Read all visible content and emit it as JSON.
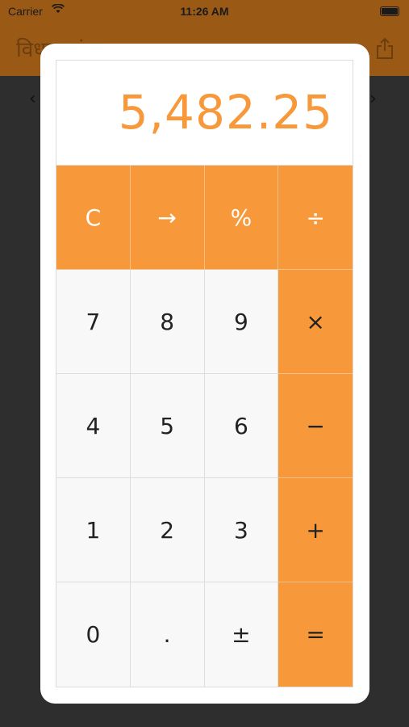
{
  "status_bar": {
    "carrier": "Carrier",
    "time": "11:26 AM"
  },
  "background_app": {
    "nav_title": "विधान संग्रह"
  },
  "calculator": {
    "display": "5,482.25",
    "keys": [
      {
        "label": "C",
        "name": "clear-key",
        "style": "orange"
      },
      {
        "label": "→",
        "name": "backspace-key",
        "style": "orange"
      },
      {
        "label": "%",
        "name": "percent-key",
        "style": "orange"
      },
      {
        "label": "÷",
        "name": "divide-key",
        "style": "orange"
      },
      {
        "label": "7",
        "name": "digit-7-key",
        "style": "light"
      },
      {
        "label": "8",
        "name": "digit-8-key",
        "style": "light"
      },
      {
        "label": "9",
        "name": "digit-9-key",
        "style": "light"
      },
      {
        "label": "×",
        "name": "multiply-key",
        "style": "op"
      },
      {
        "label": "4",
        "name": "digit-4-key",
        "style": "light"
      },
      {
        "label": "5",
        "name": "digit-5-key",
        "style": "light"
      },
      {
        "label": "6",
        "name": "digit-6-key",
        "style": "light"
      },
      {
        "label": "−",
        "name": "subtract-key",
        "style": "op"
      },
      {
        "label": "1",
        "name": "digit-1-key",
        "style": "light"
      },
      {
        "label": "2",
        "name": "digit-2-key",
        "style": "light"
      },
      {
        "label": "3",
        "name": "digit-3-key",
        "style": "light"
      },
      {
        "label": "+",
        "name": "add-key",
        "style": "op"
      },
      {
        "label": "0",
        "name": "digit-0-key",
        "style": "light"
      },
      {
        "label": ".",
        "name": "decimal-key",
        "style": "light"
      },
      {
        "label": "±",
        "name": "sign-toggle-key",
        "style": "light"
      },
      {
        "label": "=",
        "name": "equals-key",
        "style": "op"
      }
    ]
  },
  "colors": {
    "accent": "#f7993a",
    "key_light": "#f8f8f8"
  }
}
